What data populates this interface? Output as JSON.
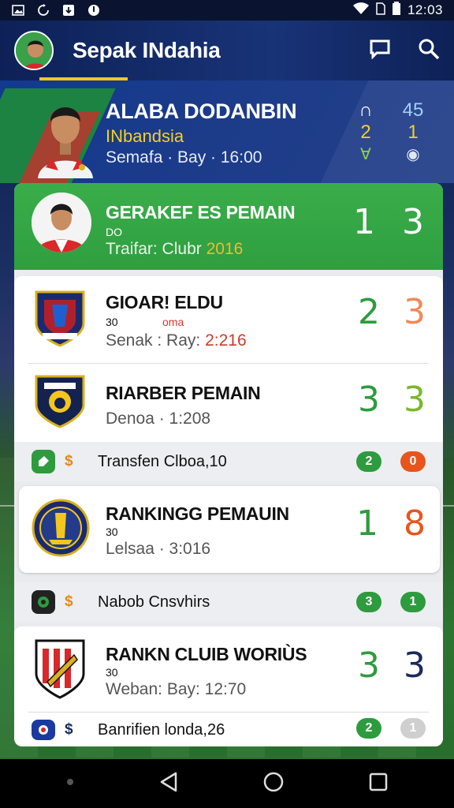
{
  "status_bar": {
    "time": "12:03"
  },
  "app_bar": {
    "title": "Sepak INdahia"
  },
  "hero": {
    "title": "ALABA DODANBIN",
    "subtitle": "INbandsia",
    "meta": "Semafa · Bay · 16:00",
    "col1": [
      "∩",
      "2",
      "∀"
    ],
    "col2": [
      "45",
      "1",
      "◉"
    ]
  },
  "featured": {
    "title": "GERAKEF ES PEMAIN",
    "small": "DO",
    "meta_prefix": "Traifar: Clubr",
    "meta_year": "2016",
    "score_a": "1",
    "score_b": "3"
  },
  "rows": [
    {
      "title": "GIOAR! ELDU",
      "small": "30",
      "small_red": "oma",
      "meta_prefix": "Senak : Ray:",
      "meta_red": "2:216",
      "score_a": "2",
      "score_b": "3"
    },
    {
      "title": "RIARBER PEMAIN",
      "meta": "Denoa · 1:208",
      "score_a": "3",
      "score_b": "3"
    },
    {
      "title": "RANKINGG PEMAUIN",
      "small": "30",
      "meta": "Lelsaa · 3:016",
      "score_a": "1",
      "score_b": "8"
    },
    {
      "title": "RANKN CLUIB WORIÙS",
      "small": "30",
      "meta": "Weban: Bay: 12:70",
      "score_a": "3",
      "score_b": "3"
    }
  ],
  "mini_rows": [
    {
      "label": "Transfen Clboa,10",
      "pill_a": "2",
      "pill_b": "0",
      "pill_a_color": "#2e9b3e",
      "pill_b_color": "#e8551c"
    },
    {
      "label": "Nabob Cnsvhirs",
      "pill_a": "3",
      "pill_b": "1",
      "pill_a_color": "#2e9b3e",
      "pill_b_color": "#2e9b3e"
    },
    {
      "label": "Banrifien londa,26",
      "pill_a": "2",
      "pill_b": "1",
      "pill_a_color": "#2e9b3e",
      "pill_b_color": "#cfcfcf"
    }
  ],
  "mini_dollar": "$",
  "colors": {
    "green": "#2e9b3e",
    "orange": "#e8551c",
    "navy": "#1a2a5a",
    "yellow": "#f2d21f"
  }
}
